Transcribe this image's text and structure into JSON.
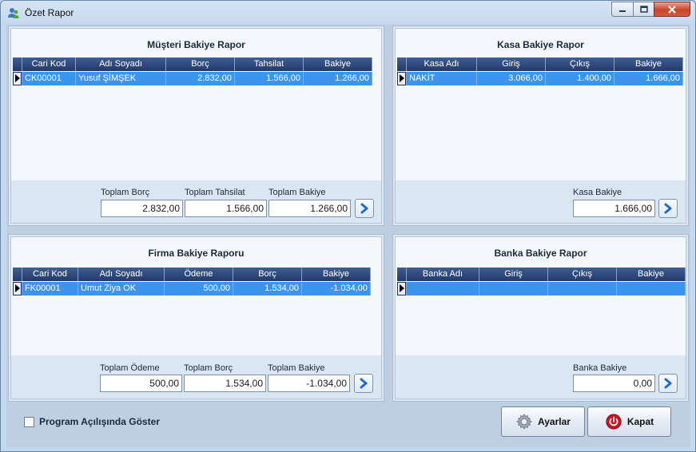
{
  "window": {
    "title": "Özet Rapor"
  },
  "musteri": {
    "title": "Müşteri Bakiye Rapor",
    "columns": [
      "Cari Kod",
      "Adı Soyadı",
      "Borç",
      "Tahsilat",
      "Bakiye"
    ],
    "rows": [
      [
        "CK00001",
        "Yusuf ŞİMŞEK",
        "2.832,00",
        "1.566,00",
        "1.266,00"
      ]
    ],
    "labels": {
      "borc": "Toplam Borç",
      "tahsilat": "Toplam Tahsilat",
      "bakiye": "Toplam Bakiye"
    },
    "values": {
      "borc": "2.832,00",
      "tahsilat": "1.566,00",
      "bakiye": "1.266,00"
    }
  },
  "kasa": {
    "title": "Kasa Bakiye Rapor",
    "columns": [
      "Kasa Adı",
      "Giriş",
      "Çıkış",
      "Bakiye"
    ],
    "rows": [
      [
        "NAKİT",
        "3.066,00",
        "1.400,00",
        "1.666,00"
      ]
    ],
    "labels": {
      "bakiye": "Kasa Bakiye"
    },
    "values": {
      "bakiye": "1.666,00"
    }
  },
  "firma": {
    "title": "Firma Bakiye Raporu",
    "columns": [
      "Cari Kod",
      "Adı Soyadı",
      "Ödeme",
      "Borç",
      "Bakiye"
    ],
    "rows": [
      [
        "FK00001",
        "Umut Ziya OK",
        "500,00",
        "1.534,00",
        "-1.034,00"
      ]
    ],
    "labels": {
      "odeme": "Toplam Ödeme",
      "borc": "Toplam Borç",
      "bakiye": "Toplam Bakiye"
    },
    "values": {
      "odeme": "500,00",
      "borc": "1.534,00",
      "bakiye": "-1.034,00"
    }
  },
  "banka": {
    "title": "Banka Bakiye Rapor",
    "columns": [
      "Banka Adı",
      "Giriş",
      "Çıkış",
      "Bakiye"
    ],
    "rows": [
      [
        "",
        "",
        "",
        ""
      ]
    ],
    "labels": {
      "bakiye": "Banka Bakiye"
    },
    "values": {
      "bakiye": "0,00"
    }
  },
  "bottom": {
    "checkbox_label": "Program Açılışında Göster",
    "settings_label": "Ayarlar",
    "close_label": "Kapat"
  },
  "colors": {
    "grid_header": "#2c4a7e",
    "grid_selected": "#3c93f0",
    "close_accent": "#c8141e"
  },
  "icons": {
    "title": "users-icon",
    "go": "arrow-right-icon",
    "settings": "gear-icon",
    "close": "power-icon"
  }
}
